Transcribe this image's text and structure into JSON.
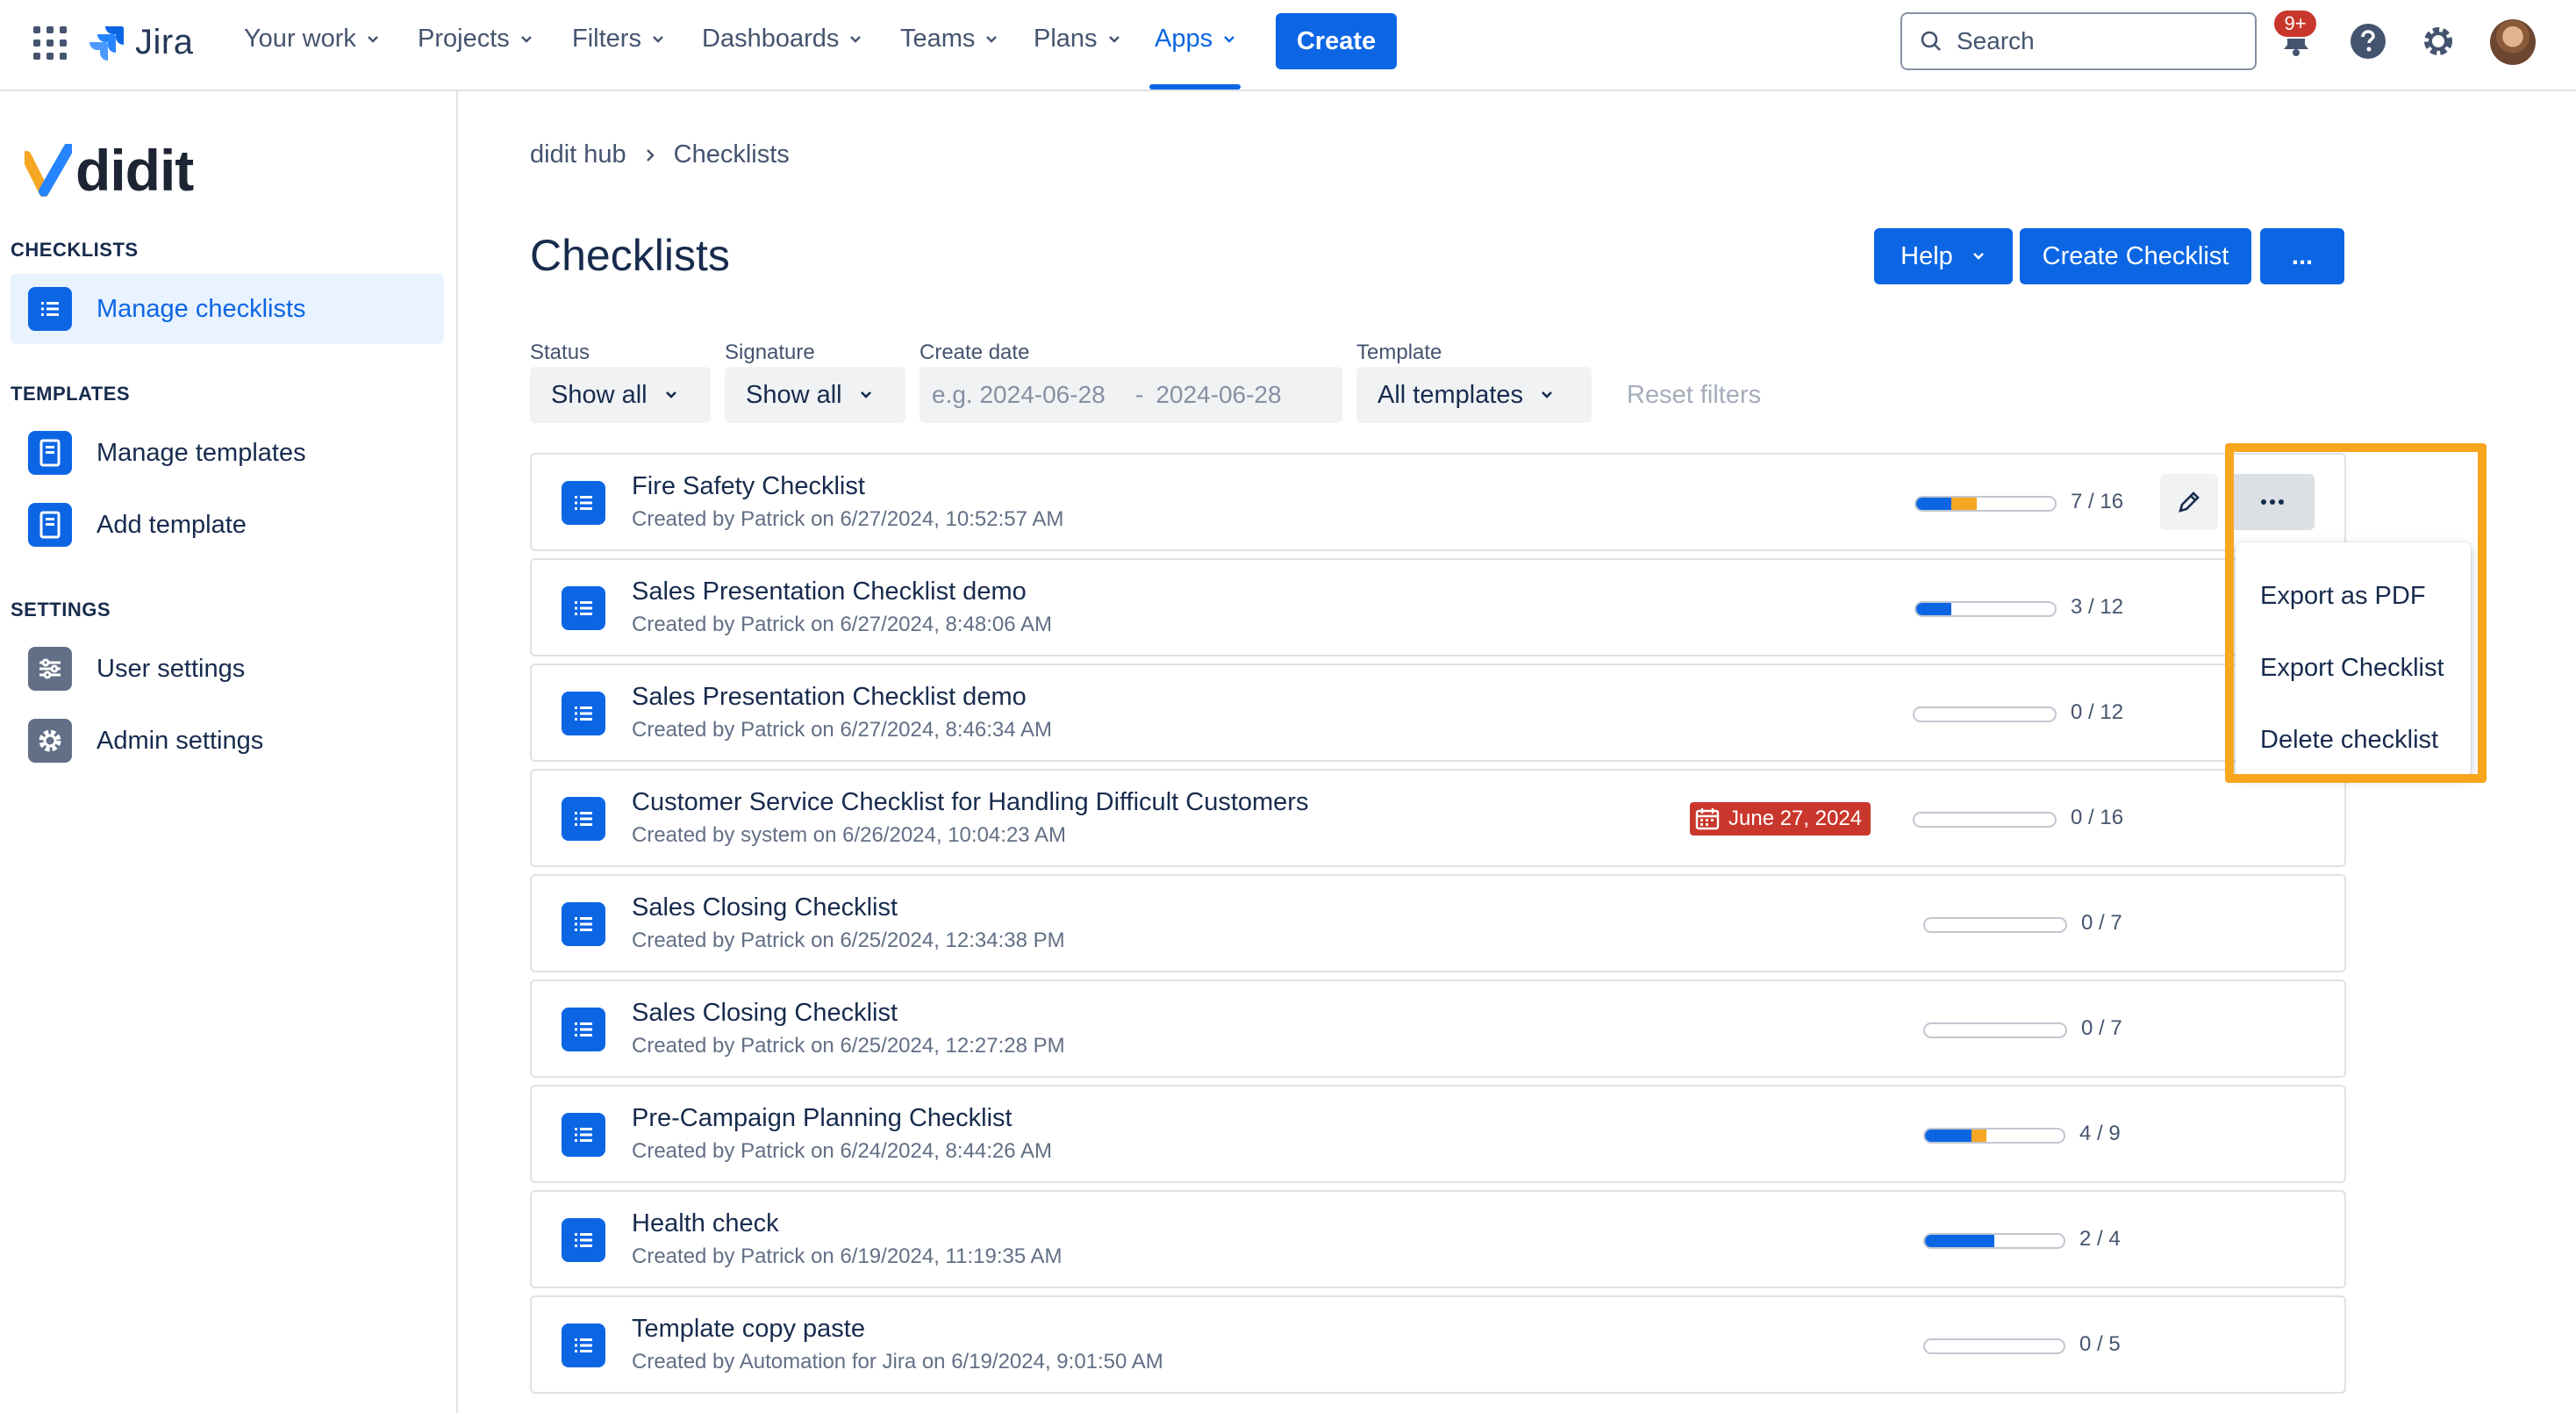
{
  "topnav": {
    "product": "Jira",
    "items": [
      {
        "label": "Your work"
      },
      {
        "label": "Projects"
      },
      {
        "label": "Filters"
      },
      {
        "label": "Dashboards"
      },
      {
        "label": "Teams"
      },
      {
        "label": "Plans"
      },
      {
        "label": "Apps",
        "active": true
      }
    ],
    "create_label": "Create",
    "search_placeholder": "Search",
    "notifications_badge": "9+",
    "icons": [
      "app-switcher-icon",
      "bell-icon",
      "help-icon",
      "gear-icon",
      "avatar"
    ],
    "accent_color": "#0c66e4"
  },
  "sidebar": {
    "brand": "didit",
    "sections": [
      {
        "heading": "CHECKLISTS",
        "items": [
          {
            "label": "Manage checklists",
            "active": true,
            "icon": "list-icon"
          }
        ]
      },
      {
        "heading": "TEMPLATES",
        "items": [
          {
            "label": "Manage templates",
            "icon": "template-icon"
          },
          {
            "label": "Add template",
            "icon": "template-icon"
          }
        ]
      },
      {
        "heading": "SETTINGS",
        "items": [
          {
            "label": "User settings",
            "icon": "sliders-icon"
          },
          {
            "label": "Admin settings",
            "icon": "gear-icon"
          }
        ]
      }
    ]
  },
  "breadcrumb": [
    "didit hub",
    "Checklists"
  ],
  "page": {
    "title": "Checklists",
    "help_label": "Help",
    "create_checklist_label": "Create Checklist",
    "more_label": "..."
  },
  "filters": {
    "status": {
      "label": "Status",
      "value": "Show all"
    },
    "signature": {
      "label": "Signature",
      "value": "Show all"
    },
    "create_date": {
      "label": "Create date",
      "from_placeholder": "e.g. 2024-06-28",
      "separator": "-",
      "to_placeholder": "2024-06-28"
    },
    "template": {
      "label": "Template",
      "value": "All templates"
    },
    "reset_label": "Reset filters"
  },
  "checklists": [
    {
      "title": "Fire Safety Checklist",
      "subtitle": "Created by Patrick on 6/27/2024, 10:52:57 AM",
      "done": 4,
      "partial": 3,
      "total": 16,
      "count": "7 / 16"
    },
    {
      "title": "Sales Presentation Checklist demo",
      "subtitle": "Created by Patrick on 6/27/2024, 8:48:06 AM",
      "done": 3,
      "partial": 0,
      "total": 12,
      "count": "3 / 12"
    },
    {
      "title": "Sales Presentation Checklist demo",
      "subtitle": "Created by Patrick on 6/27/2024, 8:46:34 AM",
      "done": 0,
      "partial": 0,
      "total": 12,
      "count": "0 / 12"
    },
    {
      "title": "Customer Service Checklist for Handling Difficult Customers",
      "subtitle": "Created by system on 6/26/2024, 10:04:23 AM",
      "done": 0,
      "partial": 0,
      "total": 16,
      "count": "0 / 16",
      "due": "June 27, 2024"
    },
    {
      "title": "Sales Closing Checklist",
      "subtitle": "Created by Patrick on 6/25/2024, 12:34:38 PM",
      "done": 0,
      "partial": 0,
      "total": 7,
      "count": "0 / 7"
    },
    {
      "title": "Sales Closing Checklist",
      "subtitle": "Created by Patrick on 6/25/2024, 12:27:28 PM",
      "done": 0,
      "partial": 0,
      "total": 7,
      "count": "0 / 7"
    },
    {
      "title": "Pre-Campaign Planning Checklist",
      "subtitle": "Created by Patrick on 6/24/2024, 8:44:26 AM",
      "done": 3,
      "partial": 1,
      "total": 9,
      "count": "4 / 9"
    },
    {
      "title": "Health check",
      "subtitle": "Created by Patrick on 6/19/2024, 11:19:35 AM",
      "done": 2,
      "partial": 0,
      "total": 4,
      "count": "2 / 4"
    },
    {
      "title": "Template copy paste",
      "subtitle": "Created by Automation for Jira on 6/19/2024, 9:01:50 AM",
      "done": 0,
      "partial": 0,
      "total": 5,
      "count": "0 / 5"
    }
  ],
  "row_menu": {
    "items": [
      "Export as PDF",
      "Export Checklist",
      "Delete checklist"
    ],
    "highlight_color": "#f7a61e"
  },
  "colors": {
    "progress_done": "#0c66e4",
    "progress_partial": "#f5a623",
    "due_badge": "#c9372c"
  }
}
